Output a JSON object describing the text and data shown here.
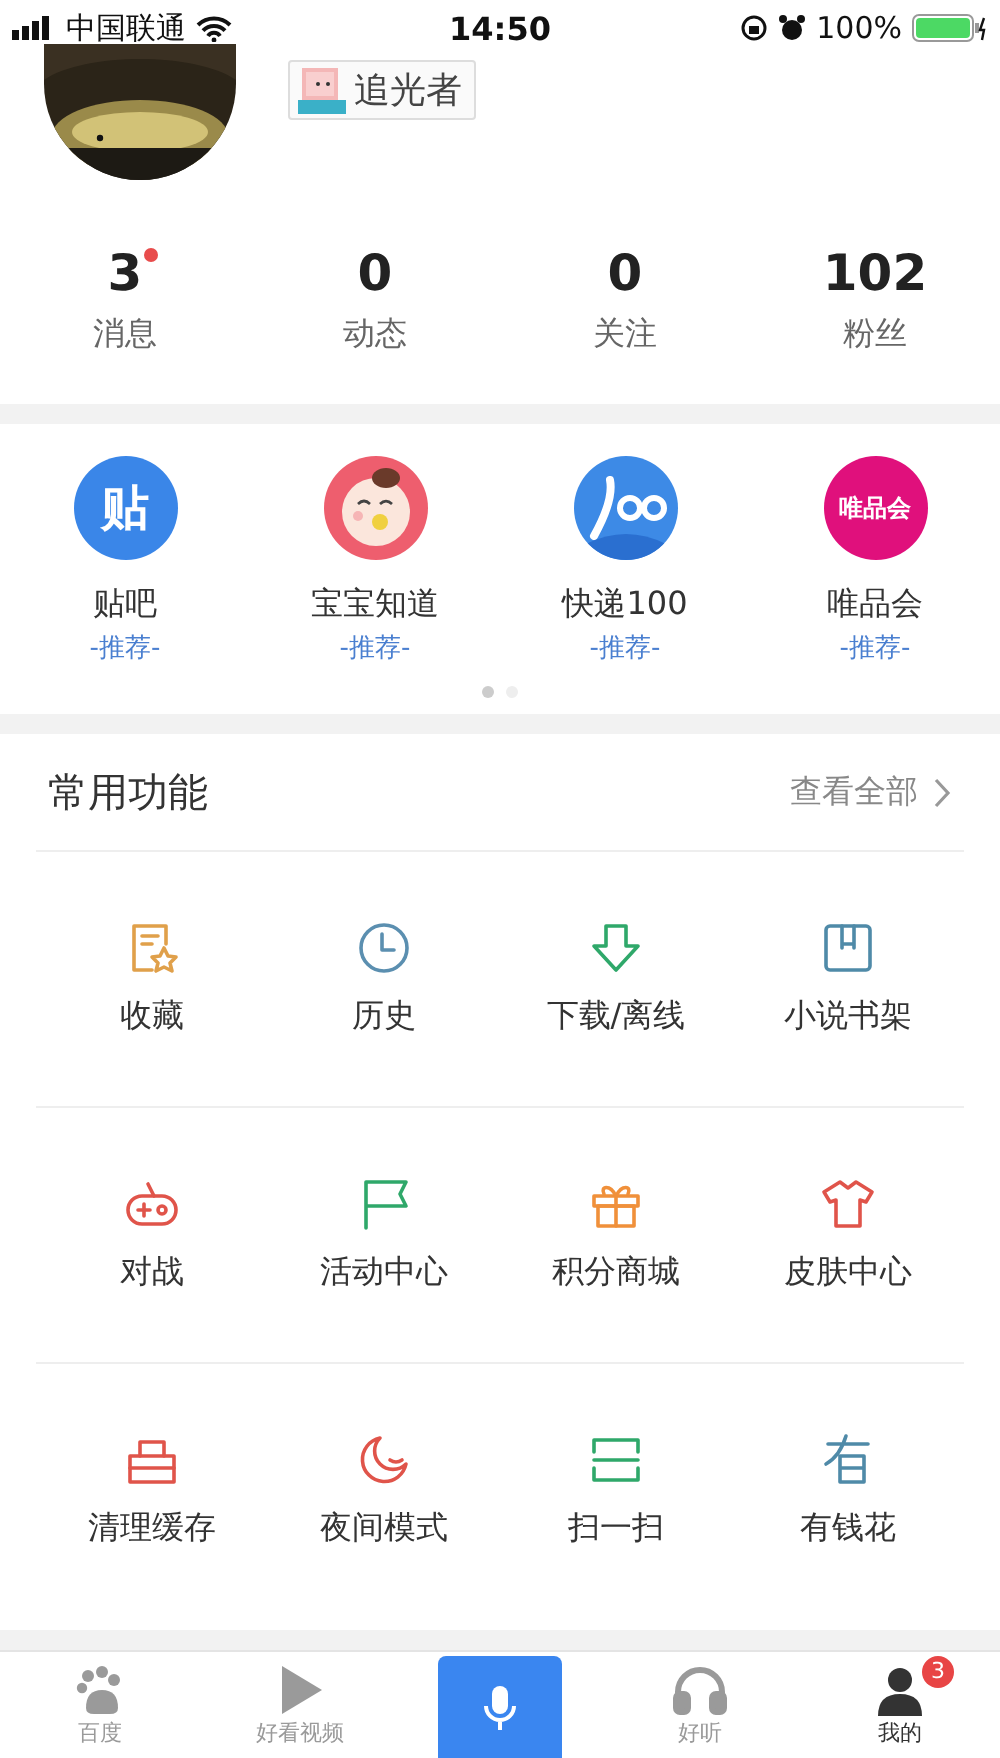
{
  "status_bar": {
    "carrier": "中国联通",
    "time": "14:50",
    "battery": "100%"
  },
  "profile": {
    "name": "追光者"
  },
  "stats": [
    {
      "value": "3",
      "label": "消息",
      "dot": true
    },
    {
      "value": "0",
      "label": "动态",
      "dot": false
    },
    {
      "value": "0",
      "label": "关注",
      "dot": false
    },
    {
      "value": "102",
      "label": "粉丝",
      "dot": false
    }
  ],
  "apps": [
    {
      "kind": "tieba",
      "icon_text": "贴",
      "name": "贴吧",
      "tag": "-推荐-",
      "color": "#3a86e8"
    },
    {
      "kind": "baby",
      "name": "宝宝知道",
      "tag": "-推荐-",
      "color": "#ee5e6e"
    },
    {
      "kind": "kuaidi",
      "name": "快递100",
      "tag": "-推荐-",
      "color": "#3d8ae6"
    },
    {
      "kind": "vip",
      "icon_text": "唯品会",
      "name": "唯品会",
      "tag": "-推荐-",
      "color": "#e0107c"
    }
  ],
  "pager": [
    {
      "selected": true
    },
    {
      "selected": false
    }
  ],
  "section": {
    "title": "常用功能",
    "more": "查看全部"
  },
  "features": [
    {
      "kind": "favorite",
      "label": "收藏",
      "color": "#e0a04a"
    },
    {
      "kind": "history",
      "label": "历史",
      "color": "#5b8fb0"
    },
    {
      "kind": "download",
      "label": "下载/离线",
      "color": "#2fa86a"
    },
    {
      "kind": "bookshelf",
      "label": "小说书架",
      "color": "#4f8aa8"
    },
    {
      "kind": "game",
      "label": "对战",
      "color": "#e0544a"
    },
    {
      "kind": "flag",
      "label": "活动中心",
      "color": "#2fa86a"
    },
    {
      "kind": "gift",
      "label": "积分商城",
      "color": "#f0903a"
    },
    {
      "kind": "shirt",
      "label": "皮肤中心",
      "color": "#e0544a"
    },
    {
      "kind": "clean",
      "label": "清理缓存",
      "color": "#e0544a"
    },
    {
      "kind": "night",
      "label": "夜间模式",
      "color": "#e0544a"
    },
    {
      "kind": "scan",
      "label": "扫一扫",
      "color": "#2fa86a"
    },
    {
      "kind": "money",
      "label": "有钱花",
      "color": "#4f8aa8"
    }
  ],
  "tab_bar": [
    {
      "kind": "paw",
      "label": "百度",
      "selected": false
    },
    {
      "kind": "play",
      "label": "好看视频",
      "selected": false
    },
    {
      "kind": "mic",
      "selected": false
    },
    {
      "kind": "headphones",
      "label": "好听",
      "selected": false
    },
    {
      "kind": "avatar",
      "label": "我的",
      "selected": true,
      "badge": "3"
    }
  ]
}
